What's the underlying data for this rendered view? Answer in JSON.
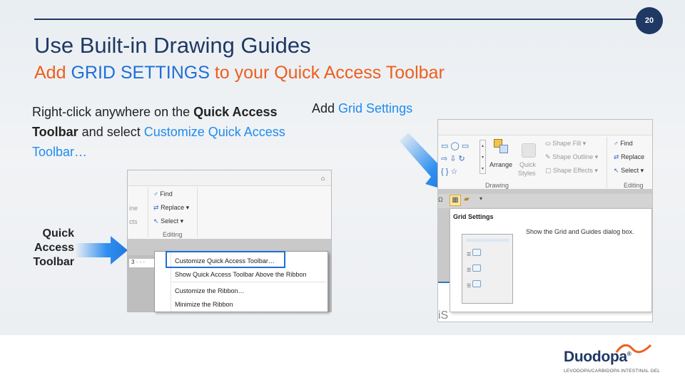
{
  "slide": {
    "page_number": "20",
    "title": "Use Built-in Drawing Guides",
    "subtitle_pre": "Add ",
    "subtitle_highlight": "GRID SETTINGS",
    "subtitle_post": " to your Quick Access Toolbar",
    "instruction_1": "Right-click anywhere on the ",
    "instruction_bold": "Quick Access Toolbar",
    "instruction_2": " and select ",
    "instruction_link": "Customize Quick Access Toolbar…",
    "add_label": "Add ",
    "add_link": "Grid Settings",
    "qat_label": "Quick Access Toolbar"
  },
  "shot1": {
    "find": "Find",
    "replace": "Replace",
    "select": "Select",
    "group": "Editing",
    "clip_1": "ine",
    "clip_2": "cts",
    "ruler": "3",
    "menu": [
      "Customize Quick Access Toolbar…",
      "Show Quick Access Toolbar Above the Ribbon",
      "Customize the Ribbon…",
      "Minimize the Ribbon"
    ]
  },
  "shot2": {
    "arrange": "Arrange",
    "quick_styles_1": "Quick",
    "quick_styles_2": "Styles",
    "shape_fill": "Shape Fill",
    "shape_outline": "Shape Outline",
    "shape_effects": "Shape Effects",
    "find": "Find",
    "replace": "Replace",
    "select": "Select",
    "group_drawing": "Drawing",
    "group_editing": "Editing",
    "tooltip_title": "Grid Settings",
    "tooltip_desc": "Show the Grid and Guides dialog box.",
    "ruler_num": "4",
    "omega": "Ω",
    "cut_text": "iS"
  },
  "brand": {
    "name": "Duodopa",
    "tagline": "LEVODOPA/CARBIDOPA INTESTINAL GEL",
    "registered": "®"
  },
  "colors": {
    "navy": "#1f3864",
    "orange": "#ed5f1e",
    "blue_highlight": "#1f8bf0",
    "arrow_blue": "#2f8ff0"
  }
}
